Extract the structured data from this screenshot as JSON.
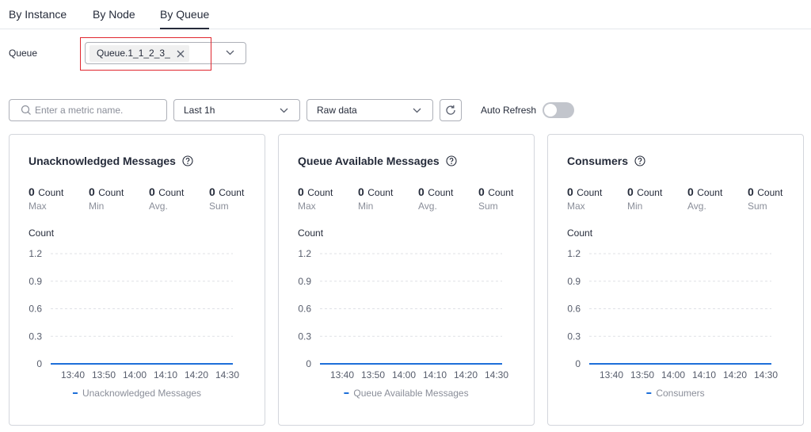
{
  "tabs": [
    {
      "label": "By Instance",
      "active": false
    },
    {
      "label": "By Node",
      "active": false
    },
    {
      "label": "By Queue",
      "active": true
    }
  ],
  "queue": {
    "label": "Queue",
    "selected_tag": "Queue.1_1_2_3_"
  },
  "toolbar": {
    "search_placeholder": "Enter a metric name.",
    "time_range": "Last 1h",
    "data_mode": "Raw data",
    "auto_refresh_label": "Auto Refresh",
    "auto_refresh_on": false
  },
  "colors": {
    "accent": "#1e6fd9",
    "highlight_box": "#e0262e",
    "muted_text": "#8a8e99"
  },
  "panels": [
    {
      "title": "Unacknowledged Messages",
      "stats": [
        {
          "value": "0",
          "unit": "Count",
          "label": "Max"
        },
        {
          "value": "0",
          "unit": "Count",
          "label": "Min"
        },
        {
          "value": "0",
          "unit": "Count",
          "label": "Avg."
        },
        {
          "value": "0",
          "unit": "Count",
          "label": "Sum"
        }
      ],
      "y_unit": "Count",
      "legend": "Unacknowledged Messages"
    },
    {
      "title": "Queue Available Messages",
      "stats": [
        {
          "value": "0",
          "unit": "Count",
          "label": "Max"
        },
        {
          "value": "0",
          "unit": "Count",
          "label": "Min"
        },
        {
          "value": "0",
          "unit": "Count",
          "label": "Avg."
        },
        {
          "value": "0",
          "unit": "Count",
          "label": "Sum"
        }
      ],
      "y_unit": "Count",
      "legend": "Queue Available Messages"
    },
    {
      "title": "Consumers",
      "stats": [
        {
          "value": "0",
          "unit": "Count",
          "label": "Max"
        },
        {
          "value": "0",
          "unit": "Count",
          "label": "Min"
        },
        {
          "value": "0",
          "unit": "Count",
          "label": "Avg."
        },
        {
          "value": "0",
          "unit": "Count",
          "label": "Sum"
        }
      ],
      "y_unit": "Count",
      "legend": "Consumers"
    }
  ],
  "chart_data": [
    {
      "type": "line",
      "ylabel": "Count",
      "y_ticks": [
        "1.2",
        "0.9",
        "0.6",
        "0.3",
        "0"
      ],
      "ylim": [
        0,
        1.2
      ],
      "x_ticks": [
        "13:40",
        "13:50",
        "14:00",
        "14:10",
        "14:20",
        "14:30"
      ],
      "series": [
        {
          "name": "Unacknowledged Messages",
          "values": [
            0,
            0,
            0,
            0,
            0,
            0
          ]
        }
      ],
      "grid": true,
      "legend_position": "bottom"
    },
    {
      "type": "line",
      "ylabel": "Count",
      "y_ticks": [
        "1.2",
        "0.9",
        "0.6",
        "0.3",
        "0"
      ],
      "ylim": [
        0,
        1.2
      ],
      "x_ticks": [
        "13:40",
        "13:50",
        "14:00",
        "14:10",
        "14:20",
        "14:30"
      ],
      "series": [
        {
          "name": "Queue Available Messages",
          "values": [
            0,
            0,
            0,
            0,
            0,
            0
          ]
        }
      ],
      "grid": true,
      "legend_position": "bottom"
    },
    {
      "type": "line",
      "ylabel": "Count",
      "y_ticks": [
        "1.2",
        "0.9",
        "0.6",
        "0.3",
        "0"
      ],
      "ylim": [
        0,
        1.2
      ],
      "x_ticks": [
        "13:40",
        "13:50",
        "14:00",
        "14:10",
        "14:20",
        "14:30"
      ],
      "series": [
        {
          "name": "Consumers",
          "values": [
            0,
            0,
            0,
            0,
            0,
            0
          ]
        }
      ],
      "grid": true,
      "legend_position": "bottom"
    }
  ]
}
